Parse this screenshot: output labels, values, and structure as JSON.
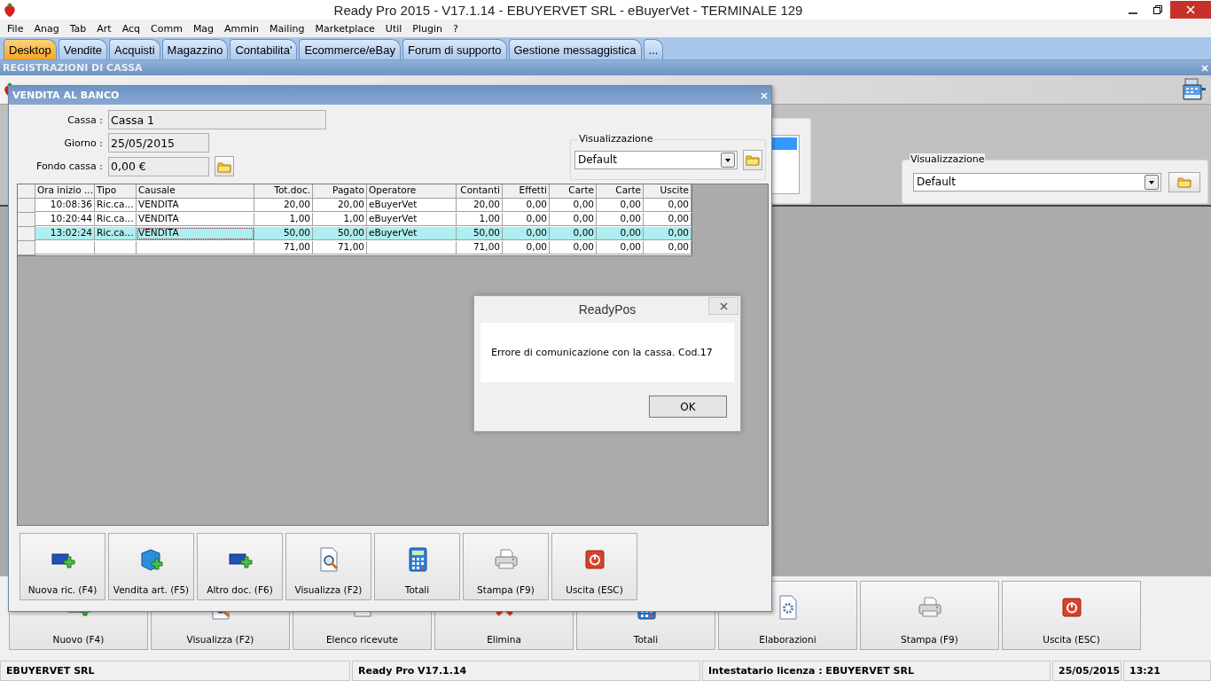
{
  "window": {
    "title": "Ready Pro 2015 - V17.1.14 - EBUYERVET SRL - eBuyerVet - TERMINALE 129"
  },
  "menu": [
    "File",
    "Anag",
    "Tab",
    "Art",
    "Acq",
    "Comm",
    "Mag",
    "Ammin",
    "Mailing",
    "Marketplace",
    "Util",
    "Plugin",
    "?"
  ],
  "tabs": [
    {
      "label": "Desktop",
      "selected": true
    },
    {
      "label": "Vendite",
      "selected": false
    },
    {
      "label": "Acquisti",
      "selected": false
    },
    {
      "label": "Magazzino",
      "selected": false
    },
    {
      "label": "Contabilita'",
      "selected": false
    },
    {
      "label": "Ecommerce/eBay",
      "selected": false
    },
    {
      "label": "Forum di supporto",
      "selected": false
    },
    {
      "label": "Gestione messaggistica",
      "selected": false
    },
    {
      "label": "...",
      "selected": false
    }
  ],
  "section": {
    "title": "REGISTRAZIONI DI CASSA"
  },
  "background": {
    "visualizzazione": {
      "legend": "Visualizzazione",
      "value": "Default"
    },
    "buttons": [
      {
        "label": "Nuovo (F4)",
        "kind": "new"
      },
      {
        "label": "Visualizza (F2)",
        "kind": "view"
      },
      {
        "label": "Elenco ricevute",
        "kind": "list"
      },
      {
        "label": "Elimina",
        "kind": "delete"
      },
      {
        "label": "Totali",
        "kind": "totals"
      },
      {
        "label": "Elaborazioni",
        "kind": "process"
      },
      {
        "label": "Stampa (F9)",
        "kind": "print"
      },
      {
        "label": "Uscita (ESC)",
        "kind": "exit"
      }
    ]
  },
  "vendita": {
    "title": "VENDITA AL BANCO",
    "fields": [
      {
        "label": "Cassa :",
        "value": "Cassa 1"
      },
      {
        "label": "Giorno :",
        "value": "25/05/2015"
      },
      {
        "label": "Fondo cassa :",
        "value": "0,00 €"
      }
    ],
    "visualizzazione": {
      "legend": "Visualizzazione",
      "value": "Default"
    },
    "table": {
      "columns": [
        "Ora inizio ...",
        "Tipo",
        "Causale",
        "Tot.doc.",
        "Pagato",
        "Operatore",
        "Contanti",
        "Effetti",
        "Carte",
        "Carte",
        "Uscite"
      ],
      "rows": [
        {
          "selected": false,
          "focused": false,
          "cells": [
            "10:08:36",
            "Ric.ca...",
            "VENDITA",
            "20,00",
            "20,00",
            "eBuyerVet",
            "20,00",
            "0,00",
            "0,00",
            "0,00",
            "0,00"
          ]
        },
        {
          "selected": false,
          "focused": false,
          "cells": [
            "10:20:44",
            "Ric.ca...",
            "VENDITA",
            "1,00",
            "1,00",
            "eBuyerVet",
            "1,00",
            "0,00",
            "0,00",
            "0,00",
            "0,00"
          ]
        },
        {
          "selected": true,
          "focused": true,
          "cells": [
            "13:02:24",
            "Ric.ca...",
            "VENDITA",
            "50,00",
            "50,00",
            "eBuyerVet",
            "50,00",
            "0,00",
            "0,00",
            "0,00",
            "0,00"
          ]
        }
      ],
      "totals": [
        "71,00",
        "71,00",
        "71,00",
        "0,00",
        "0,00",
        "0,00",
        "0,00"
      ]
    },
    "buttons": [
      {
        "label": "Nuova ric. (F4)",
        "kind": "new"
      },
      {
        "label": "Vendita art. (F5)",
        "kind": "cube"
      },
      {
        "label": "Altro doc. (F6)",
        "kind": "new"
      },
      {
        "label": "Visualizza (F2)",
        "kind": "view"
      },
      {
        "label": "Totali",
        "kind": "totals"
      },
      {
        "label": "Stampa (F9)",
        "kind": "print"
      },
      {
        "label": "Uscita (ESC)",
        "kind": "exit"
      }
    ]
  },
  "dialog": {
    "title": "ReadyPos",
    "message": "Errore di comunicazione con la cassa. Cod.17",
    "button": "OK"
  },
  "status_bar": [
    "EBUYERVET SRL",
    "Ready Pro V17.1.14",
    "Intestatario licenza : EBUYERVET SRL",
    "25/05/2015",
    "13:21"
  ]
}
